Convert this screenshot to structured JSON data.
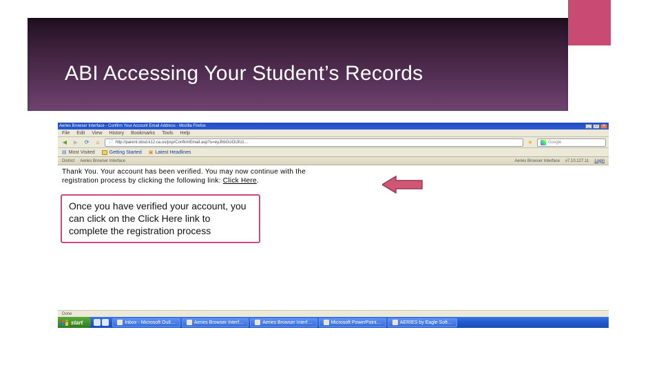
{
  "slide": {
    "title": "ABI Accessing Your Student’s Records"
  },
  "browser": {
    "window_title": "Aeries Browser Interface - Confirm Your Account Email Address - Mozilla Firefox",
    "menu": {
      "file": "File",
      "edit": "Edit",
      "view": "View",
      "history": "History",
      "bookmarks": "Bookmarks",
      "tools": "Tools",
      "help": "Help"
    },
    "url": "http://parent.sbsd.k12.ca.us/psp/ConfirmEmail.asp?u=eyJhbGciOiJIUz…",
    "search_placeholder": "Google",
    "bookmarks_bar": {
      "label": "Most Visited",
      "items": [
        "Getting Started",
        "Latest Headlines"
      ]
    },
    "sys_left": [
      "District",
      "Aeries Browser Interface"
    ],
    "sys_right": [
      "Aeries Browser Interface",
      "v7.10.127.11",
      "Login"
    ],
    "page_text_1": "Thank You. Your account has been verified. You may now continue with the",
    "page_text_2": "registration process by clicking the following link: ",
    "page_link_text": "Click Here",
    "page_text_3": ".",
    "status": "Done"
  },
  "callout": {
    "text": "Once you have verified your account, you can click on the Click Here link to complete the registration process"
  },
  "taskbar": {
    "start": "start",
    "buttons": [
      "Inbox - Microsoft Outl…",
      "Aeries Browser Interf…",
      "Aeries Browser Interf…",
      "Microsoft PowerPoint…",
      "AERIES by Eagle Soft…"
    ]
  }
}
